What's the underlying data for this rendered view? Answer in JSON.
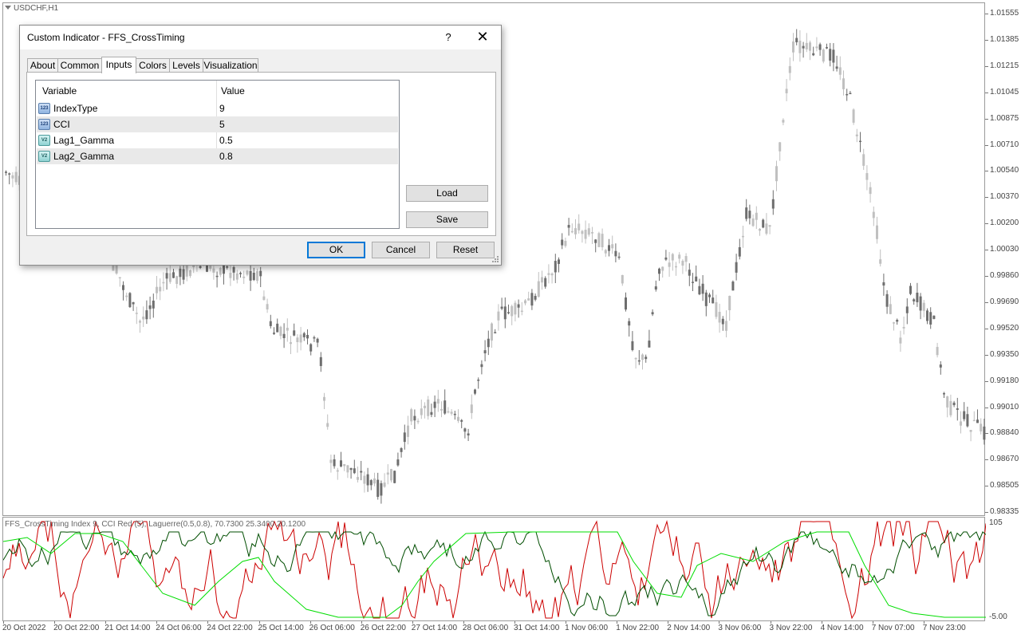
{
  "chart": {
    "symbol": "USDCHF,H1",
    "price_labels": [
      "1.01555",
      "1.01385",
      "1.01215",
      "1.01045",
      "1.00875",
      "1.00710",
      "1.00540",
      "1.00370",
      "1.00200",
      "1.00030",
      "0.99860",
      "0.99690",
      "0.99520",
      "0.99350",
      "0.99180",
      "0.99010",
      "0.98840",
      "0.98670",
      "0.98505",
      "0.98335"
    ],
    "time_labels": [
      "20 Oct 2022",
      "20 Oct 22:00",
      "21 Oct 14:00",
      "24 Oct 06:00",
      "24 Oct 22:00",
      "25 Oct 14:00",
      "26 Oct 06:00",
      "26 Oct 22:00",
      "27 Oct 14:00",
      "28 Oct 06:00",
      "31 Oct 14:00",
      "1 Nov 06:00",
      "1 Nov 22:00",
      "2 Nov 14:00",
      "3 Nov 06:00",
      "3 Nov 22:00",
      "4 Nov 14:00",
      "7 Nov 07:00",
      "7 Nov 23:00"
    ],
    "bull_color": "#c0c0c0",
    "bear_color": "#6e6e6e"
  },
  "indicator": {
    "title": "FFS_CrossTiming  Index 9, CCI Red (5), Laguerre(0.5,0.8),  70.7300 25.3400 20.1200",
    "scale_top": "105",
    "scale_bottom": "-5.00",
    "colors": {
      "red": "#cc0000",
      "dark_green": "#004d00",
      "green": "#00dd00"
    }
  },
  "dialog": {
    "title": "Custom Indicator - FFS_CrossTiming",
    "help_label": "?",
    "close_label": "✕",
    "tabs": [
      "About",
      "Common",
      "Inputs",
      "Colors",
      "Levels",
      "Visualization"
    ],
    "active_tab": "Inputs",
    "table": {
      "col_variable": "Variable",
      "col_value": "Value",
      "rows": [
        {
          "icon": "int-type-icon",
          "icon_text": "123",
          "name": "IndexType",
          "value": "9"
        },
        {
          "icon": "int-type-icon",
          "icon_text": "123",
          "name": "CCI",
          "value": "5"
        },
        {
          "icon": "double-type-icon",
          "icon_text": "V2",
          "name": "Lag1_Gamma",
          "value": "0.5"
        },
        {
          "icon": "double-type-icon",
          "icon_text": "V2",
          "name": "Lag2_Gamma",
          "value": "0.8"
        }
      ]
    },
    "load_label": "Load",
    "save_label": "Save",
    "ok_label": "OK",
    "cancel_label": "Cancel",
    "reset_label": "Reset"
  }
}
